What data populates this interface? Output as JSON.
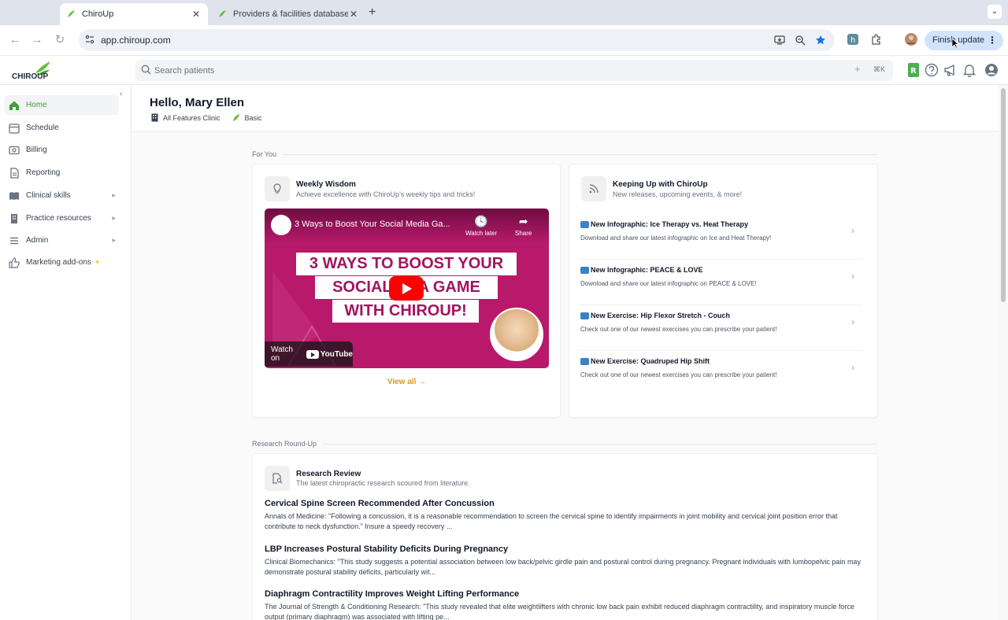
{
  "browser": {
    "tabs": [
      {
        "title": "ChiroUp",
        "active": true
      },
      {
        "title": "Providers & facilities database",
        "active": false
      }
    ],
    "url": "app.chiroup.com",
    "finish_update_label": "Finish update"
  },
  "header": {
    "logo_text": "CHIROUP",
    "search_placeholder": "Search patients",
    "search_shortcut": "⌘K"
  },
  "sidebar": {
    "items": [
      {
        "label": "Home",
        "icon": "home-icon",
        "active": true
      },
      {
        "label": "Schedule",
        "icon": "calendar-icon"
      },
      {
        "label": "Billing",
        "icon": "billing-icon"
      },
      {
        "label": "Reporting",
        "icon": "report-icon"
      },
      {
        "label": "Clinical skills",
        "icon": "book-icon",
        "expandable": true
      },
      {
        "label": "Practice resources",
        "icon": "building-icon",
        "expandable": true
      },
      {
        "label": "Admin",
        "icon": "list-icon",
        "expandable": true
      },
      {
        "label": "Marketing add-ons",
        "icon": "thumbs-up-icon"
      }
    ]
  },
  "page": {
    "greeting": "Hello, Mary Ellen",
    "clinic": "All Features Clinic",
    "plan": "Basic"
  },
  "for_you": {
    "label": "For You",
    "weekly_wisdom": {
      "title": "Weekly Wisdom",
      "subtitle": "Achieve excellence with ChiroUp's weekly tips and tricks!",
      "video": {
        "title": "3 Ways to Boost Your Social Media Ga...",
        "watch_later": "Watch later",
        "share": "Share",
        "line1": "3 WAYS TO BOOST YOUR",
        "line2": "SOCIAL M      IA GAME",
        "line3": "WITH CHIROUP!",
        "watch_on": "Watch on",
        "youtube": "YouTube"
      },
      "view_all": "View all →"
    },
    "keeping_up": {
      "title": "Keeping Up with ChiroUp",
      "subtitle": "New releases, upcoming events, & more!",
      "items": [
        {
          "title": "New Infographic: Ice Therapy vs. Heat Therapy",
          "desc": "Download and share our latest infographic on Ice and Heat Therapy!"
        },
        {
          "title": "New Infographic: PEACE & LOVE",
          "desc": "Download and share our latest infographic on PEACE & LOVE!"
        },
        {
          "title": "New Exercise: Hip Flexor Stretch - Couch",
          "desc": "Check out one of our newest exercises you can prescribe your patient!"
        },
        {
          "title": "New Exercise: Quadruped Hip Shift",
          "desc": "Check out one of our newest exercises you can prescribe your patient!"
        }
      ]
    }
  },
  "research": {
    "label": "Research Round-Up",
    "title": "Research Review",
    "subtitle": "The latest chiropractic research scoured from literature.",
    "items": [
      {
        "title": "Cervical Spine Screen Recommended After Concussion",
        "desc": "Annals of Medicine: \"Following a concussion, it is a reasonable recommendation to screen the cervical spine to identify impairments in joint mobility and cervical joint position error that contribute to neck dysfunction.\" Insure a speedy recovery ..."
      },
      {
        "title": "LBP Increases Postural Stability Deficits During Pregnancy",
        "desc": "Clinical Biomechanics: \"This study suggests a potential association between low back/pelvic girdle pain and postural control during pregnancy. Pregnant individuals with lumbopelvic pain may demonstrate postural stability deficits, particularly wit..."
      },
      {
        "title": "Diaphragm Contractility Improves Weight Lifting Performance",
        "desc": "The Journal of Strength & Conditioning Research: \"This study revealed that elite weightlifters with chronic low back pain exhibit reduced diaphragm contractility, and inspiratory muscle force output (primary diaphragm) was associated with lifting pe..."
      }
    ]
  },
  "colors": {
    "brand_green": "#3f9e35",
    "accent_gold": "#d59a1c",
    "video_magenta": "#b8196b"
  }
}
